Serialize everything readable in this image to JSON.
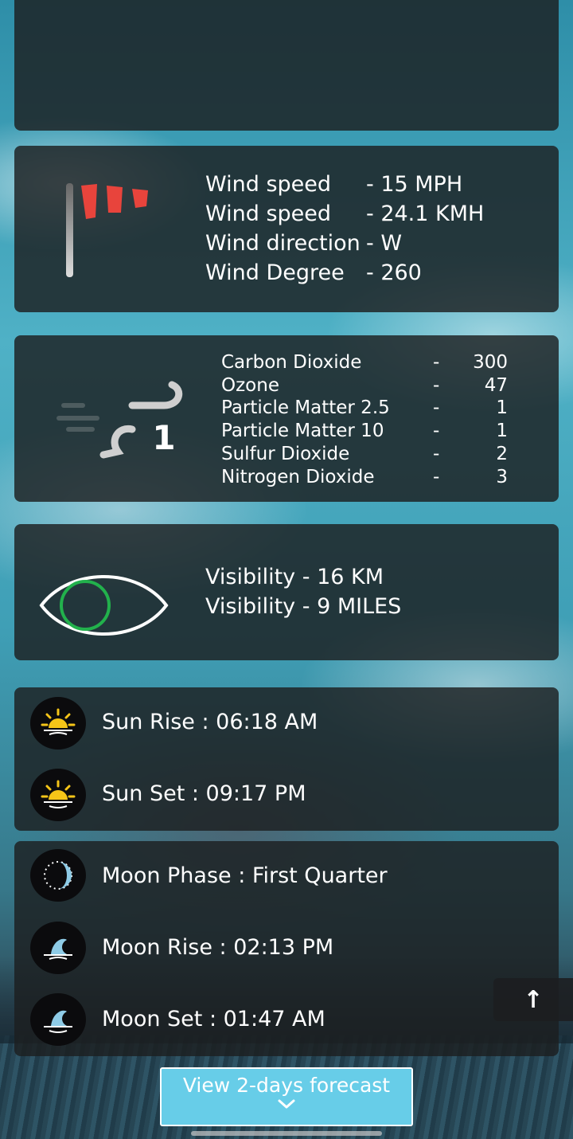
{
  "wind": {
    "rows": [
      {
        "label": "Wind speed",
        "value": "- 15 MPH"
      },
      {
        "label": "Wind speed",
        "value": "- 24.1 KMH"
      },
      {
        "label": "Wind direction",
        "value": "- W"
      },
      {
        "label": "Wind Degree",
        "value": "- 260"
      }
    ]
  },
  "air_quality": {
    "index": "1",
    "rows": [
      {
        "label": "Carbon Dioxide",
        "dash": "-",
        "value": "300"
      },
      {
        "label": "Ozone",
        "dash": "-",
        "value": "47"
      },
      {
        "label": "Particle Matter 2.5",
        "dash": "-",
        "value": "1"
      },
      {
        "label": "Particle Matter 10",
        "dash": "-",
        "value": "1"
      },
      {
        "label": "Sulfur Dioxide",
        "dash": "-",
        "value": "2"
      },
      {
        "label": "Nitrogen Dioxide",
        "dash": "-",
        "value": "3"
      }
    ]
  },
  "visibility": {
    "km": "Visibility - 16 KM",
    "miles": "Visibility - 9 MILES"
  },
  "sun": {
    "rise": "Sun Rise :  06:18 AM",
    "set": "Sun Set :  09:17 PM"
  },
  "moon": {
    "phase": "Moon Phase :  First Quarter",
    "rise": "Moon Rise :  02:13 PM",
    "set": "Moon Set :  01:47 AM"
  },
  "forecast_button": {
    "label": "View 2-days forecast"
  },
  "scroll_top": {
    "symbol": "↑"
  },
  "colors": {
    "card_bg": "#1c1e20",
    "windsock_red": "#e8443c",
    "eye_iris": "#22b14c",
    "button_bg": "#67cde8",
    "sun_yellow": "#f5c518",
    "moon_blue": "#8ecbe6"
  }
}
